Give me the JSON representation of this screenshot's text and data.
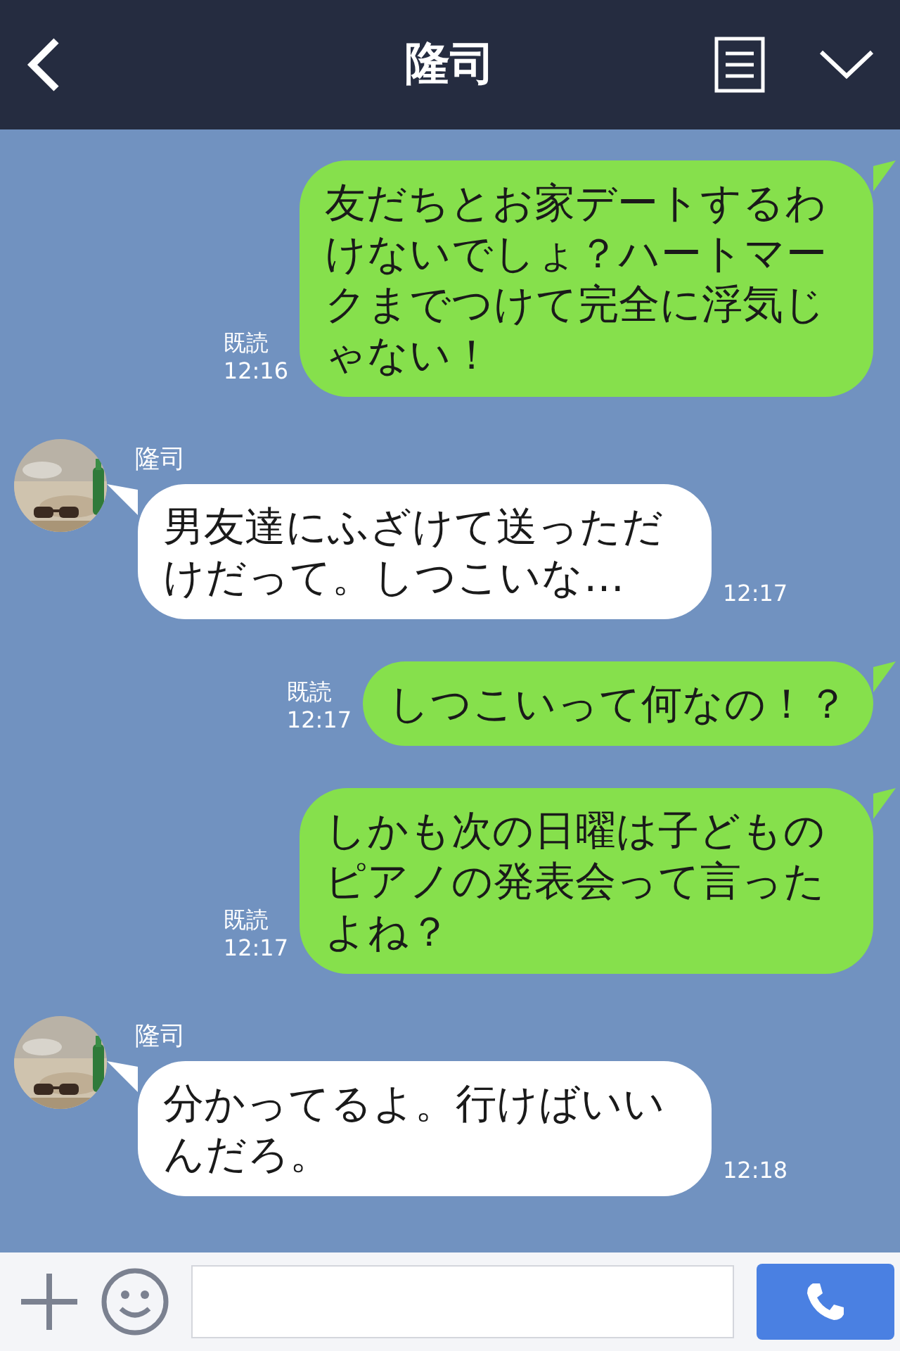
{
  "header": {
    "title": "隆司"
  },
  "messages": [
    {
      "kind": "sent",
      "text": "友だちとお家デートするわけないでしょ？ハートマークまでつけて完全に浮気じゃない！",
      "read": "既読",
      "time": "12:16"
    },
    {
      "kind": "received",
      "sender": "隆司",
      "text": "男友達にふざけて送っただけだって。しつこいな…",
      "time": "12:17"
    },
    {
      "kind": "sent",
      "text": "しつこいって何なの！？",
      "read": "既読",
      "time": "12:17"
    },
    {
      "kind": "sent",
      "text": "しかも次の日曜は子どものピアノの発表会って言ったよね？",
      "read": "既読",
      "time": "12:17"
    },
    {
      "kind": "received",
      "sender": "隆司",
      "text": "分かってるよ。行けばいいんだろ。",
      "time": "12:18"
    }
  ]
}
